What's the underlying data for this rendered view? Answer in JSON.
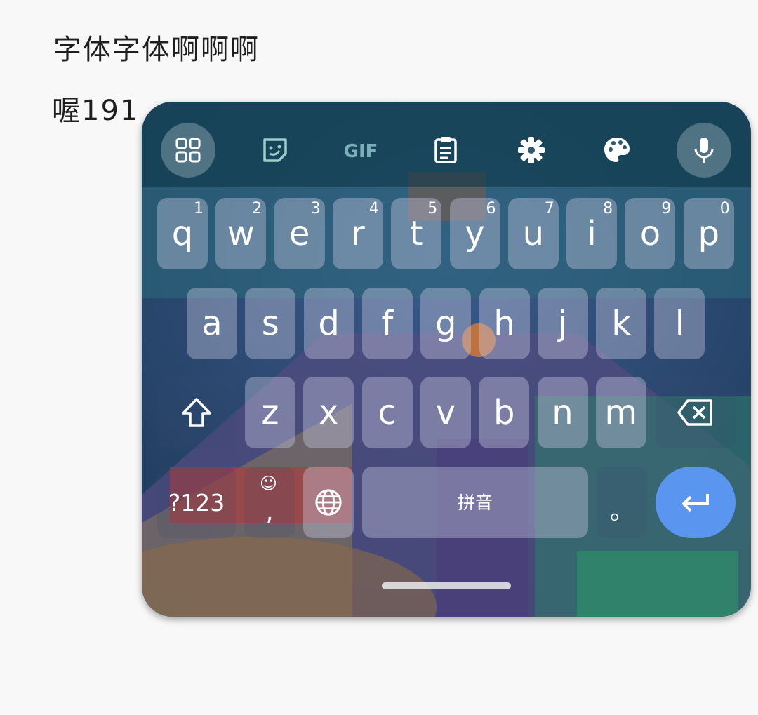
{
  "document": {
    "lines": [
      "字体字体啊啊啊",
      "喔191"
    ]
  },
  "keyboard": {
    "toolbar": {
      "items": [
        "apps-icon",
        "sticker-icon",
        "gif-icon",
        "clipboard-icon",
        "settings-icon",
        "theme-palette-icon",
        "microphone-icon"
      ],
      "gif_label": "GIF"
    },
    "rows": [
      [
        {
          "label": "q",
          "hint": "1"
        },
        {
          "label": "w",
          "hint": "2"
        },
        {
          "label": "e",
          "hint": "3"
        },
        {
          "label": "r",
          "hint": "4"
        },
        {
          "label": "t",
          "hint": "5"
        },
        {
          "label": "y",
          "hint": "6"
        },
        {
          "label": "u",
          "hint": "7"
        },
        {
          "label": "i",
          "hint": "8"
        },
        {
          "label": "o",
          "hint": "9"
        },
        {
          "label": "p",
          "hint": "0"
        }
      ],
      [
        {
          "label": "a"
        },
        {
          "label": "s"
        },
        {
          "label": "d"
        },
        {
          "label": "f"
        },
        {
          "label": "g"
        },
        {
          "label": "h"
        },
        {
          "label": "j"
        },
        {
          "label": "k"
        },
        {
          "label": "l"
        }
      ],
      [
        {
          "label": "z"
        },
        {
          "label": "x"
        },
        {
          "label": "c"
        },
        {
          "label": "v"
        },
        {
          "label": "b"
        },
        {
          "label": "n"
        },
        {
          "label": "m"
        }
      ]
    ],
    "bottom": {
      "symbols_label": "?123",
      "comma_label": ",",
      "space_label": "拼音",
      "period_label": "。"
    },
    "accent_color": "#5a96f0"
  }
}
